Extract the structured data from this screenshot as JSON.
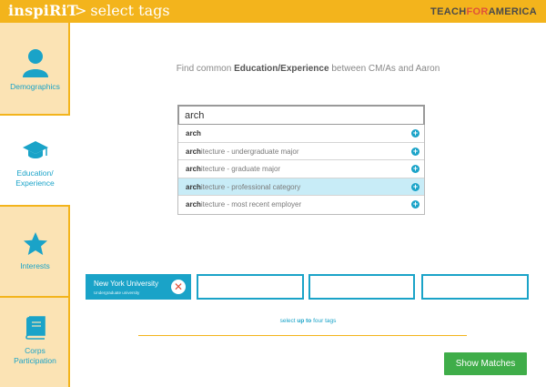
{
  "header": {
    "app_title": "inspiRiT",
    "separator": ">",
    "page_title": "select tags",
    "brand": {
      "part1": "TEACH",
      "part2": "FOR",
      "part3": "AMERICA"
    }
  },
  "sidebar": {
    "items": [
      {
        "label": "Demographics",
        "icon": "person-icon",
        "active": false
      },
      {
        "label_line1": "Education/",
        "label_line2": "Experience",
        "icon": "graduation-cap-icon",
        "active": true
      },
      {
        "label": "Interests",
        "icon": "star-icon",
        "active": false
      },
      {
        "label_line1": "Corps",
        "label_line2": "Participation",
        "icon": "book-icon",
        "active": false
      }
    ]
  },
  "prompt": {
    "prefix": "Find common ",
    "emphasis": "Education/Experience",
    "suffix": " between CM/As and Aaron"
  },
  "search": {
    "value": "arch"
  },
  "results": [
    {
      "match": "arch",
      "rest": "",
      "highlight": false
    },
    {
      "match": "arch",
      "rest": "itecture - undergraduate major",
      "highlight": false
    },
    {
      "match": "arch",
      "rest": "itecture - graduate major",
      "highlight": false
    },
    {
      "match": "arch",
      "rest": "itecture - professional category",
      "highlight": true
    },
    {
      "match": "arch",
      "rest": "itecture - most recent employer",
      "highlight": false
    }
  ],
  "tag_slots": [
    {
      "title": "New York University",
      "subtitle": "Undergraduate university",
      "filled": true
    },
    {
      "filled": false
    },
    {
      "filled": false
    },
    {
      "filled": false
    }
  ],
  "hint": {
    "prefix": "select ",
    "emphasis": "up to",
    "suffix": " four tags"
  },
  "show_matches_label": "Show Matches",
  "colors": {
    "header": "#f3b41c",
    "accent": "#1aa3c8",
    "sidebar_inactive": "#fbe3b4",
    "button_green": "#3fad49",
    "remove_red": "#e0523a"
  }
}
